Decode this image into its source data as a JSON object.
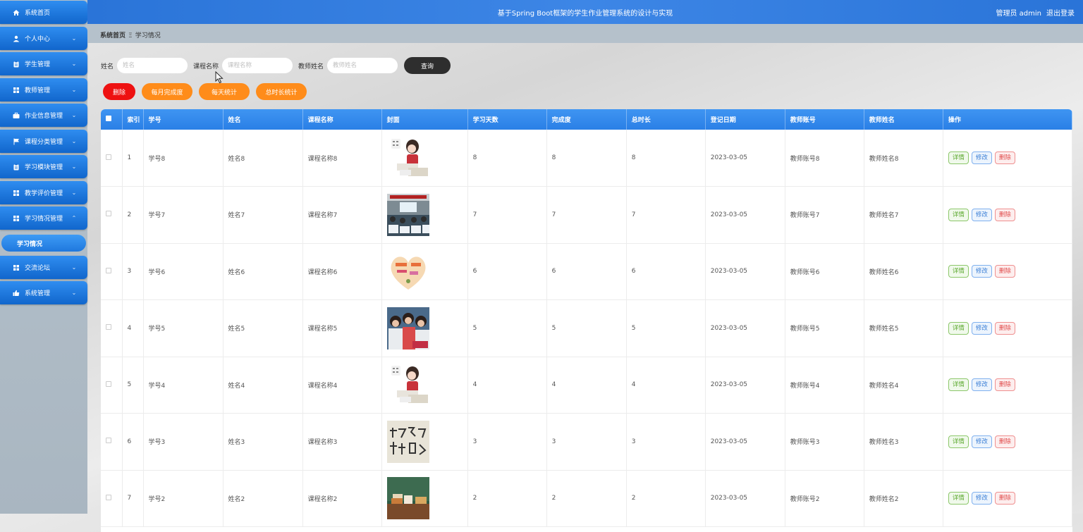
{
  "app": {
    "title": "基于Spring Boot框架的学生作业管理系统的设计与实现",
    "user_label": "管理员 admin",
    "logout_label": "退出登录"
  },
  "sidebar": {
    "items": [
      {
        "label": "系统首页",
        "icon": "home-icon",
        "chevron": ""
      },
      {
        "label": "个人中心",
        "icon": "user-icon",
        "chevron": "⌄"
      },
      {
        "label": "学生管理",
        "icon": "clipboard-icon",
        "chevron": "⌄"
      },
      {
        "label": "教师管理",
        "icon": "grid-icon",
        "chevron": "⌄"
      },
      {
        "label": "作业信息管理",
        "icon": "briefcase-icon",
        "chevron": "⌄"
      },
      {
        "label": "课程分类管理",
        "icon": "flag-icon",
        "chevron": "⌄"
      },
      {
        "label": "学习模块管理",
        "icon": "clipboard-icon",
        "chevron": "⌄"
      },
      {
        "label": "教学评价管理",
        "icon": "grid-icon",
        "chevron": "⌄"
      },
      {
        "label": "学习情况管理",
        "icon": "grid-icon",
        "chevron": "⌃"
      },
      {
        "label": "交流论坛",
        "icon": "grid-icon",
        "chevron": "⌄"
      },
      {
        "label": "系统管理",
        "icon": "thumb-icon",
        "chevron": "⌄"
      }
    ],
    "active_sub": "学习情况"
  },
  "breadcrumb": {
    "root": "系统首页",
    "separator": "Ξ",
    "current": "学习情况"
  },
  "search": {
    "fields": [
      {
        "label": "姓名",
        "placeholder": "姓名"
      },
      {
        "label": "课程名称",
        "placeholder": "课程名称"
      },
      {
        "label": "教师姓名",
        "placeholder": "教师姓名"
      }
    ],
    "query_label": "查询"
  },
  "actions": {
    "delete_label": "删除",
    "monthly_label": "每月完成度",
    "daily_label": "每天统计",
    "total_label": "总时长统计"
  },
  "table": {
    "columns": [
      "",
      "索引",
      "学号",
      "姓名",
      "课程名称",
      "封面",
      "学习天数",
      "完成度",
      "总时长",
      "登记日期",
      "教师账号",
      "教师姓名",
      "操作"
    ],
    "ops": {
      "detail": "详情",
      "edit": "修改",
      "delete": "删除"
    },
    "rows": [
      {
        "index": "1",
        "student_no": "学号8",
        "name": "姓名8",
        "course": "课程名称8",
        "cover": "girl-reading",
        "days": "8",
        "completion": "8",
        "duration": "8",
        "date": "2023-03-05",
        "teacher_account": "教师账号8",
        "teacher_name": "教师姓名8"
      },
      {
        "index": "2",
        "student_no": "学号7",
        "name": "姓名7",
        "course": "课程名称7",
        "cover": "classroom",
        "days": "7",
        "completion": "7",
        "duration": "7",
        "date": "2023-03-05",
        "teacher_account": "教师账号7",
        "teacher_name": "教师姓名7"
      },
      {
        "index": "3",
        "student_no": "学号6",
        "name": "姓名6",
        "course": "课程名称6",
        "cover": "heart",
        "days": "6",
        "completion": "6",
        "duration": "6",
        "date": "2023-03-05",
        "teacher_account": "教师账号6",
        "teacher_name": "教师姓名6"
      },
      {
        "index": "4",
        "student_no": "学号5",
        "name": "姓名5",
        "course": "课程名称5",
        "cover": "students",
        "days": "5",
        "completion": "5",
        "duration": "5",
        "date": "2023-03-05",
        "teacher_account": "教师账号5",
        "teacher_name": "教师姓名5"
      },
      {
        "index": "5",
        "student_no": "学号4",
        "name": "姓名4",
        "course": "课程名称4",
        "cover": "girl-reading",
        "days": "4",
        "completion": "4",
        "duration": "4",
        "date": "2023-03-05",
        "teacher_account": "教师账号4",
        "teacher_name": "教师姓名4"
      },
      {
        "index": "6",
        "student_no": "学号3",
        "name": "姓名3",
        "course": "课程名称3",
        "cover": "calligraphy",
        "days": "3",
        "completion": "3",
        "duration": "3",
        "date": "2023-03-05",
        "teacher_account": "教师账号3",
        "teacher_name": "教师姓名3"
      },
      {
        "index": "7",
        "student_no": "学号2",
        "name": "姓名2",
        "course": "课程名称2",
        "cover": "chalkboard",
        "days": "2",
        "completion": "2",
        "duration": "2",
        "date": "2023-03-05",
        "teacher_account": "教师账号2",
        "teacher_name": "教师姓名2"
      }
    ]
  },
  "colors": {
    "header_blue": "#2a74d8",
    "danger": "#ee1111",
    "orange": "#ff8c1a",
    "dark": "#2e2e2e"
  }
}
